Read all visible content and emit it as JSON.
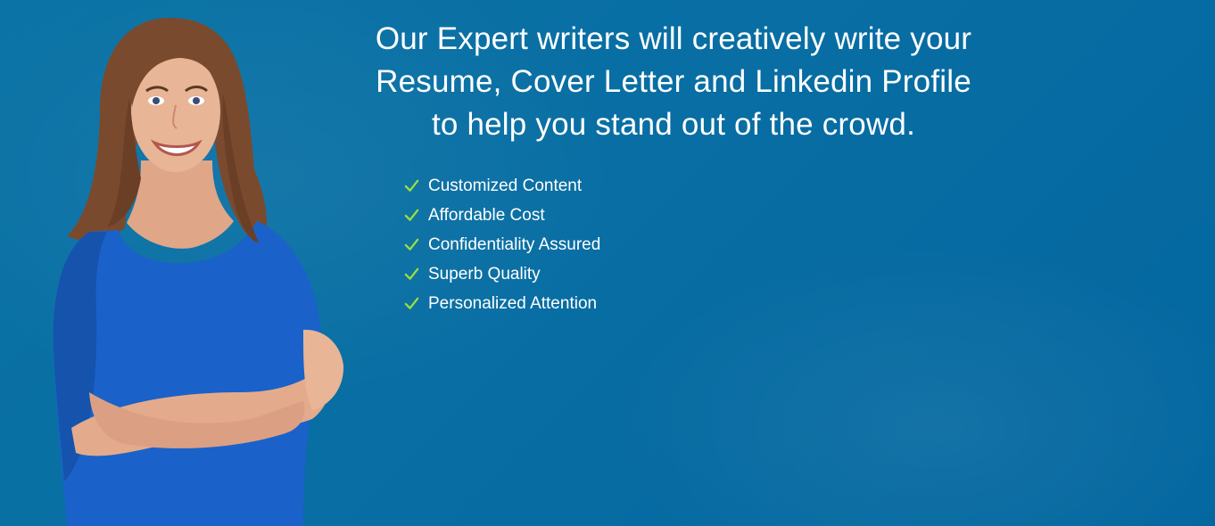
{
  "headline": {
    "line1": "Our Expert writers will creatively write your",
    "line2": "Resume, Cover Letter and Linkedin Profile",
    "line3": "to help you stand out of the crowd."
  },
  "features": [
    {
      "label": "Customized Content",
      "icon": "check-icon"
    },
    {
      "label": "Affordable Cost",
      "icon": "check-icon"
    },
    {
      "label": "Confidentiality Assured",
      "icon": "check-icon"
    },
    {
      "label": "Superb Quality",
      "icon": "check-icon"
    },
    {
      "label": "Personalized Attention",
      "icon": "check-icon"
    }
  ],
  "colors": {
    "background": "#086ea3",
    "text": "#ffffff",
    "check": "#9be03a",
    "shirt": "#1a62c9",
    "hair": "#7a4a2e",
    "skin": "#e8b596"
  }
}
